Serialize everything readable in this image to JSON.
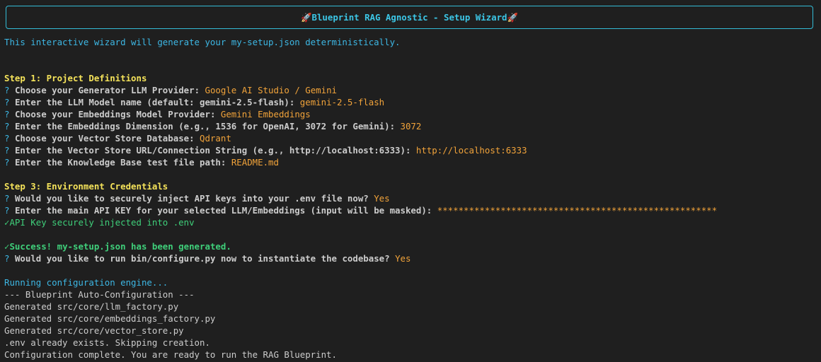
{
  "banner": {
    "icon_left": "🚀",
    "title": "Blueprint RAG Agnostic - Setup Wizard",
    "icon_right": "🚀"
  },
  "intro": "This interactive wizard will generate your my-setup.json deterministically.",
  "step1": {
    "heading": "Step 1: Project Definitions",
    "prompts": [
      {
        "question": "Choose your Generator LLM Provider:",
        "answer": "Google AI Studio / Gemini"
      },
      {
        "question": "Enter the LLM Model name (default: gemini-2.5-flash):",
        "answer": "gemini-2.5-flash"
      },
      {
        "question": "Choose your Embeddings Model Provider:",
        "answer": "Gemini Embeddings"
      },
      {
        "question": "Enter the Embeddings Dimension (e.g., 1536 for OpenAI, 3072 for Gemini):",
        "answer": "3072"
      },
      {
        "question": "Choose your Vector Store Database:",
        "answer": "Qdrant"
      },
      {
        "question": "Enter the Vector Store URL/Connection String (e.g., http://localhost:6333):",
        "answer": "http://localhost:6333"
      },
      {
        "question": "Enter the Knowledge Base test file path:",
        "answer": "README.md"
      }
    ]
  },
  "step3": {
    "heading": "Step 3: Environment Credentials",
    "prompts": [
      {
        "question": "Would you like to securely inject API keys into your .env file now?",
        "answer": "Yes"
      },
      {
        "question": "Enter the main API KEY for your selected LLM/Embeddings (input will be masked):",
        "answer": "*****************************************************"
      }
    ],
    "confirmation": "API Key securely injected into .env"
  },
  "success": "Success! my-setup.json has been generated.",
  "run_prompt": {
    "question": "Would you like to run bin/configure.py now to instantiate the codebase?",
    "answer": "Yes"
  },
  "engine": {
    "running": "Running configuration engine...",
    "output": [
      "--- Blueprint Auto-Configuration ---",
      "Generated src/core/llm_factory.py",
      "Generated src/core/embeddings_factory.py",
      "Generated src/core/vector_store.py",
      ".env already exists. Skipping creation.",
      "Configuration complete. You are ready to run the RAG Blueprint."
    ]
  },
  "glyphs": {
    "question_mark": "?",
    "check_mark": "✓"
  },
  "colors": {
    "background": "#1f1f1f",
    "cyan": "#3db7e4",
    "yellow": "#f5e35a",
    "orange": "#f1a33a",
    "green": "#3fcf7a",
    "text": "#cccccc"
  }
}
